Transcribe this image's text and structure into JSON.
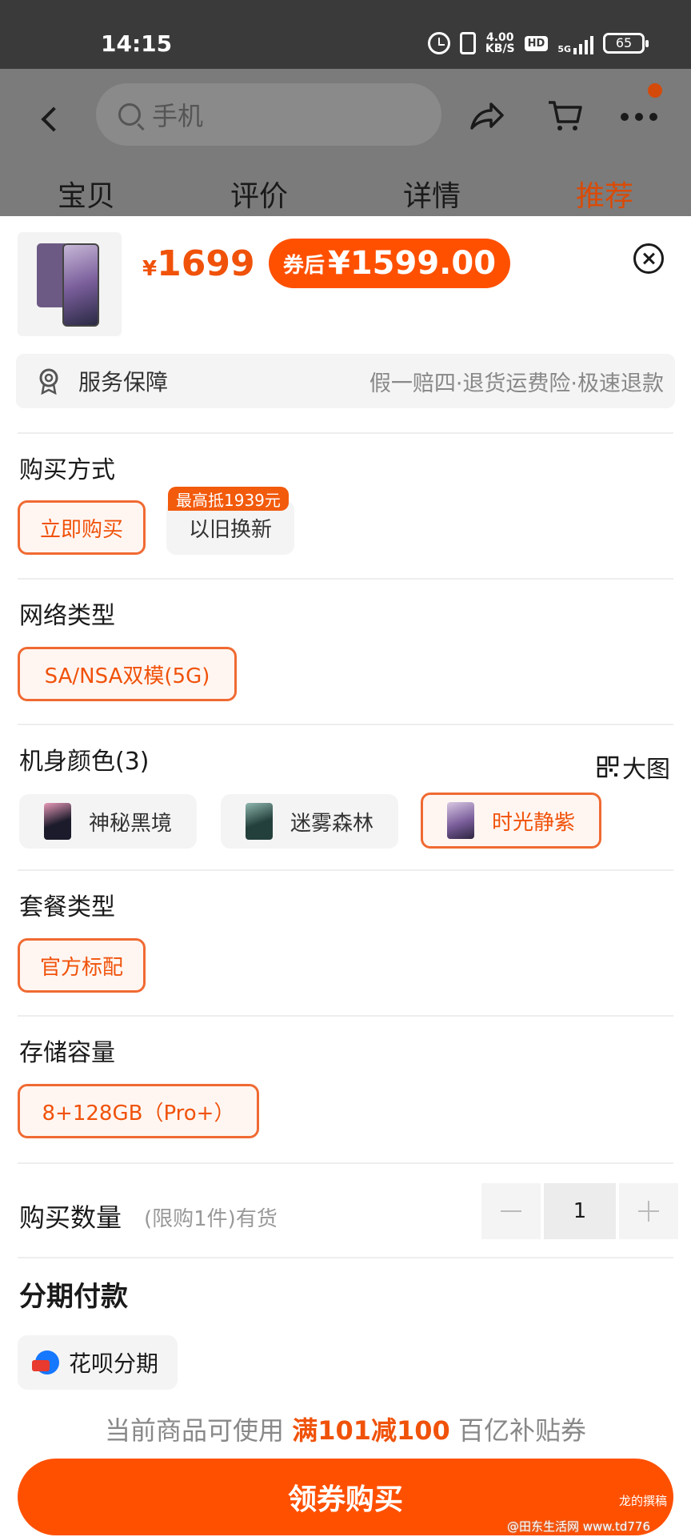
{
  "status_bar": {
    "time": "14:15",
    "net_speed_value": "4.00",
    "net_speed_unit": "KB/S",
    "hd": "HD",
    "signal": "5G",
    "battery": "65"
  },
  "header": {
    "search_placeholder": "手机",
    "tabs": [
      {
        "label": "宝贝",
        "active": false
      },
      {
        "label": "评价",
        "active": false
      },
      {
        "label": "详情",
        "active": false
      },
      {
        "label": "推荐",
        "active": true
      }
    ],
    "notification_dot_color": "#d44a0a"
  },
  "product": {
    "price_symbol": "¥",
    "price": "1699",
    "coupon_label": "券后",
    "coupon_price": "¥1599.00"
  },
  "service": {
    "title": "服务保障",
    "desc": "假一赔四·退货运费险·极速退款"
  },
  "sections": {
    "purchase_method": {
      "title": "购买方式",
      "options": [
        {
          "label": "立即购买",
          "selected": true
        },
        {
          "label": "以旧换新",
          "selected": false
        }
      ],
      "badge": "最高抵1939元"
    },
    "network": {
      "title": "网络类型",
      "options": [
        {
          "label": "SA/NSA双模(5G)",
          "selected": true
        }
      ]
    },
    "color": {
      "title": "机身颜色(3)",
      "big_image_label": "大图",
      "options": [
        {
          "label": "神秘黑境",
          "selected": false
        },
        {
          "label": "迷雾森林",
          "selected": false
        },
        {
          "label": "时光静紫",
          "selected": true
        }
      ]
    },
    "package": {
      "title": "套餐类型",
      "options": [
        {
          "label": "官方标配",
          "selected": true
        }
      ]
    },
    "storage": {
      "title": "存储容量",
      "options": [
        {
          "label": "8+128GB（Pro+）",
          "selected": true
        }
      ]
    }
  },
  "quantity": {
    "title": "购买数量",
    "sub": "(限购1件)有货",
    "value": "1"
  },
  "installment": {
    "title": "分期付款",
    "option": "花呗分期"
  },
  "promo": {
    "prefix": "当前商品可使用 ",
    "highlight": "满101减100",
    "suffix": " 百亿补贴券"
  },
  "buy_button": "领券购买",
  "watermark": {
    "line1": "龙的撰稿",
    "line2": "@田东生活网 www.td776"
  },
  "colors": {
    "accent": "#ff5000",
    "price": "#f0520a",
    "selected_border": "#f06a32"
  }
}
